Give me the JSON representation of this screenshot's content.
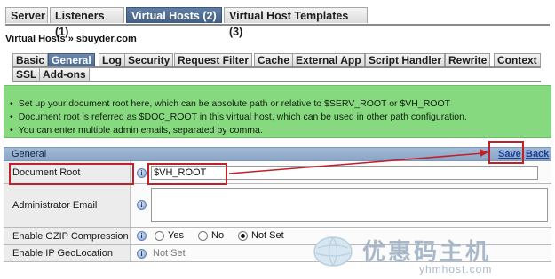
{
  "top_tabs": [
    {
      "label": "Server",
      "active": false
    },
    {
      "label": "Listeners (1)",
      "active": false
    },
    {
      "label": "Virtual Hosts (2)",
      "active": true
    },
    {
      "label": "Virtual Host Templates (3)",
      "active": false
    }
  ],
  "page_title": "Virtual Hosts » sbuyder.com",
  "sub_tabs_row1": [
    "Basic",
    "General",
    "Log",
    "Security",
    "Request Filter",
    "Cache",
    "External App",
    "Script Handler",
    "Rewrite",
    "Context"
  ],
  "sub_tabs_row2": [
    "SSL",
    "Add-ons"
  ],
  "active_sub_tab": "General",
  "info_lines": [
    "Set up your document root here, which can be absolute path or relative to $SERV_ROOT or $VH_ROOT",
    "Document root is referred as $DOC_ROOT in this virtual host, which can be used in other path configuration.",
    "You can enter multiple admin emails, separated by comma."
  ],
  "section": {
    "title": "General",
    "save_label": "Save",
    "back_label": "Back"
  },
  "fields": {
    "document_root": {
      "label": "Document Root",
      "value": "$VH_ROOT"
    },
    "admin_email": {
      "label": "Administrator Email",
      "value": ""
    },
    "gzip": {
      "label": "Enable GZIP Compression",
      "options": [
        "Yes",
        "No",
        "Not Set"
      ],
      "selected": "Not Set"
    },
    "geolocation": {
      "label": "Enable IP GeoLocation",
      "value": "Not Set"
    }
  },
  "help_icon_glyph": "i",
  "watermark": {
    "text": "优惠码主机",
    "url": "yhmhost.com"
  },
  "colors": {
    "info_bg": "#86d97e",
    "active_tab": "#4b6890",
    "highlight": "#c0202a",
    "link": "#1c3f9e"
  }
}
